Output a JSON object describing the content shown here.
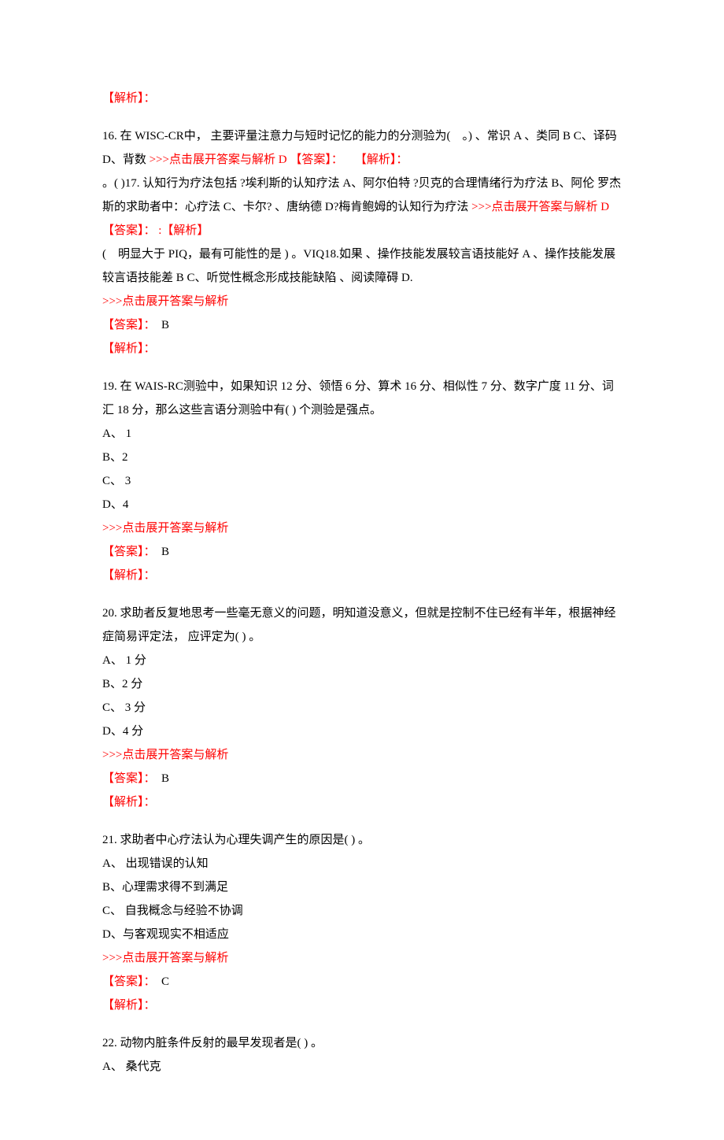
{
  "labels": {
    "expand": ">>>点击展开答案与解析",
    "answer": "【答案】：",
    "explain": "【解析】："
  },
  "q16": {
    "textA": "16. 在 WISC-CR中， 主要评量注意力与短时记忆的能力的分测验为(　。)  、常识 A 、类同 B C、译码 D、背数 ",
    "inlineD": " D 【答案】：　　【解析】：",
    "q17a": " 。( )17.  认知行为疗法包括  ?埃利斯的认知疗法 A、阿尔伯特  ?贝克的合理情绪行为疗法 B、阿伦  罗杰斯的求助者中：心疗法 C、卡尔?  、唐纳德 D?梅肯鲍姆的认知行为疗法 ",
    "inlineD2": " D 【答案】： :【解析】",
    "q18a": "(　明显大于 PIQ，最有可能性的是 )  。VIQ18.如果  、操作技能发展较言语技能好 A  、操作技能发展较言语技能差 B C、听觉性概念形成技能缺陷  、阅读障碍 D.",
    "ans": "　B"
  },
  "q19": {
    "text": "19. 在 WAIS-RC测验中，如果知识 12 分、领悟 6 分、算术 16 分、相似性 7 分、数字广度 11 分、词汇 18 分，那么这些言语分测验中有( )  个测验是强点。",
    "a": "A、 1",
    "b": "B、2",
    "c": "C、 3",
    "d": "D、4",
    "ans": "　B"
  },
  "q20": {
    "text": "20. 求助者反复地思考一些毫无意义的问题，明知道没意义，但就是控制不住已经有半年，根据神经症简易评定法， 应评定为( ) 。",
    "a": "A、 1 分",
    "b": "B、2 分",
    "c": "C、 3 分",
    "d": "D、4 分",
    "ans": "　B"
  },
  "q21": {
    "text": "21. 求助者中心疗法认为心理失调产生的原因是( ) 。",
    "a": "A、  出现错误的认知",
    "b": "B、心理需求得不到满足",
    "c": "C、  自我概念与经验不协调",
    "d": "D、与客观现实不相适应",
    "ans": "　C"
  },
  "q22": {
    "text": "22. 动物内脏条件反射的最早发现者是( ) 。",
    "a": "A、  桑代克"
  }
}
